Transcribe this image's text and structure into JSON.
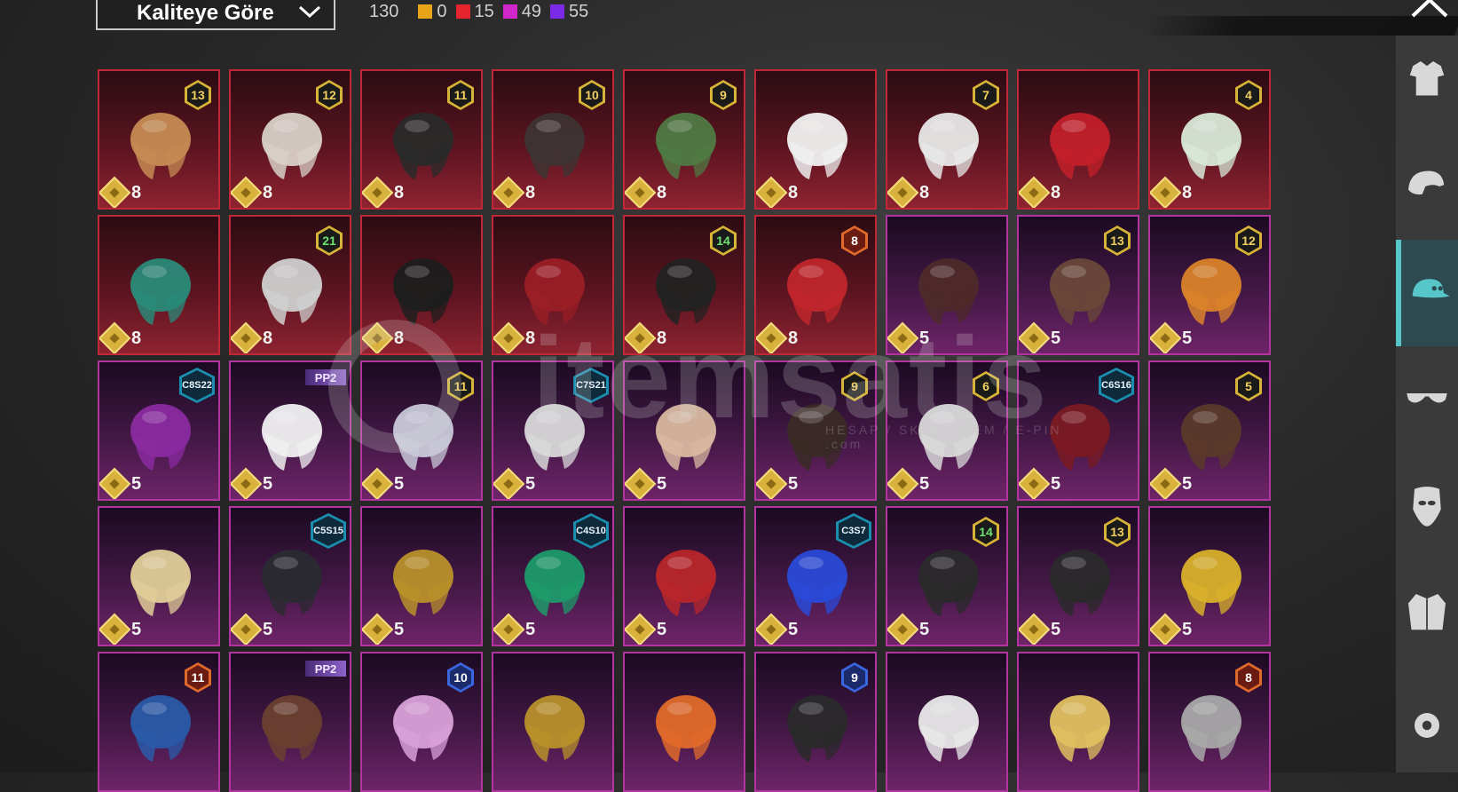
{
  "header": {
    "sort_label": "Kaliteye Göre",
    "total_count": "130",
    "stats": [
      {
        "color": "#e8a316",
        "value": "0"
      },
      {
        "color": "#e4252e",
        "value": "15"
      },
      {
        "color": "#d126c9",
        "value": "49"
      },
      {
        "color": "#7a2ae6",
        "value": "55"
      }
    ]
  },
  "watermark": {
    "text": "itemsatis",
    "sub": "HESAP / SKIN / ITEM / E-PIN .com"
  },
  "items": [
    {
      "rarity": "red",
      "badge": "13",
      "badge_type": "gold",
      "cost": "8",
      "icon": "flat-hat-hair-icon",
      "tone": "#c58b53"
    },
    {
      "rarity": "red",
      "badge": "12",
      "badge_type": "gold",
      "cost": "8",
      "icon": "silver-hair-icon",
      "tone": "#d8d0c8"
    },
    {
      "rarity": "red",
      "badge": "11",
      "badge_type": "gold",
      "cost": "8",
      "icon": "black-hair-icon",
      "tone": "#2a2a2a"
    },
    {
      "rarity": "red",
      "badge": "10",
      "badge_type": "gold",
      "cost": "8",
      "icon": "dark-hair-icon",
      "tone": "#3e3434"
    },
    {
      "rarity": "red",
      "badge": "9",
      "badge_type": "gold",
      "cost": "8",
      "icon": "zombie-head-icon",
      "tone": "#4f7a44"
    },
    {
      "rarity": "red",
      "badge": "",
      "badge_type": "none",
      "cost": "8",
      "icon": "white-cowboy-hat-icon",
      "tone": "#f0f0f0"
    },
    {
      "rarity": "red",
      "badge": "7",
      "badge_type": "gold",
      "cost": "8",
      "icon": "white-long-hair-icon",
      "tone": "#e8e8e8"
    },
    {
      "rarity": "red",
      "badge": "",
      "badge_type": "none",
      "cost": "8",
      "icon": "red-helmet-icon",
      "tone": "#c1202a"
    },
    {
      "rarity": "red",
      "badge": "4",
      "badge_type": "gold",
      "cost": "8",
      "icon": "snowman-top-hat-icon",
      "tone": "#d8e8d8"
    },
    {
      "rarity": "red",
      "badge": "",
      "badge_type": "none",
      "cost": "8",
      "icon": "dragon-mask-icon",
      "tone": "#2a8a78"
    },
    {
      "rarity": "red",
      "badge": "21",
      "badge_type": "green",
      "cost": "8",
      "icon": "oni-mask-icon",
      "tone": "#cfcfcf"
    },
    {
      "rarity": "red",
      "badge": "",
      "badge_type": "none",
      "cost": "8",
      "icon": "fox-mask-icon",
      "tone": "#1e1e1e"
    },
    {
      "rarity": "red",
      "badge": "",
      "badge_type": "none",
      "cost": "8",
      "icon": "red-visor-helmet-icon",
      "tone": "#9a1e26"
    },
    {
      "rarity": "red",
      "badge": "14",
      "badge_type": "green",
      "cost": "8",
      "icon": "golden-antler-hood-icon",
      "tone": "#222222"
    },
    {
      "rarity": "red",
      "badge": "8",
      "badge_type": "orange",
      "cost": "8",
      "icon": "red-samurai-hat-icon",
      "tone": "#c0262c"
    },
    {
      "rarity": "purple",
      "badge": "",
      "badge_type": "none",
      "cost": "5",
      "icon": "brown-hair-icon",
      "tone": "#4e2a2a"
    },
    {
      "rarity": "purple",
      "badge": "13",
      "badge_type": "gold",
      "cost": "5",
      "icon": "goggles-hair-icon",
      "tone": "#6a4838"
    },
    {
      "rarity": "purple",
      "badge": "12",
      "badge_type": "gold",
      "cost": "5",
      "icon": "orange-hair-icon",
      "tone": "#d9822a"
    },
    {
      "rarity": "purple",
      "badge": "C8S22",
      "badge_type": "season",
      "cost": "5",
      "icon": "purple-hair-icon",
      "tone": "#8a2aa0"
    },
    {
      "rarity": "purple",
      "badge": "PP2",
      "badge_type": "pass",
      "cost": "5",
      "icon": "panda-head-icon",
      "tone": "#f0f0f0"
    },
    {
      "rarity": "purple",
      "badge": "11",
      "badge_type": "gold",
      "cost": "5",
      "icon": "flower-crown-hair-icon",
      "tone": "#c8c8d8"
    },
    {
      "rarity": "purple",
      "badge": "C7S21",
      "badge_type": "season",
      "cost": "5",
      "icon": "silver-spiky-hair-icon",
      "tone": "#d8d8d8"
    },
    {
      "rarity": "purple",
      "badge": "",
      "badge_type": "none",
      "cost": "5",
      "icon": "blonde-buns-hair-icon",
      "tone": "#d8b8a0"
    },
    {
      "rarity": "purple",
      "badge": "9",
      "badge_type": "gold",
      "cost": "5",
      "icon": "ponytail-hair-icon",
      "tone": "#3a2a26"
    },
    {
      "rarity": "purple",
      "badge": "6",
      "badge_type": "gold",
      "cost": "5",
      "icon": "bird-helmet-icon",
      "tone": "#d8d8d8"
    },
    {
      "rarity": "purple",
      "badge": "C6S16",
      "badge_type": "season",
      "cost": "5",
      "icon": "red-hair-icon",
      "tone": "#7a1a22"
    },
    {
      "rarity": "purple",
      "badge": "5",
      "badge_type": "gold",
      "cost": "5",
      "icon": "bunny-ears-hair-icon",
      "tone": "#5a3a2a"
    },
    {
      "rarity": "purple",
      "badge": "",
      "badge_type": "none",
      "cost": "5",
      "icon": "blonde-curls-hair-icon",
      "tone": "#e0cc98"
    },
    {
      "rarity": "purple",
      "badge": "C5S15",
      "badge_type": "season",
      "cost": "5",
      "icon": "black-cap-icon",
      "tone": "#2a2a30"
    },
    {
      "rarity": "purple",
      "badge": "",
      "badge_type": "none",
      "cost": "5",
      "icon": "golden-anubis-helmet-icon",
      "tone": "#b8902a"
    },
    {
      "rarity": "purple",
      "badge": "C4S10",
      "badge_type": "season",
      "cost": "5",
      "icon": "green-dragon-helmet-icon",
      "tone": "#1e9a6a"
    },
    {
      "rarity": "purple",
      "badge": "",
      "badge_type": "none",
      "cost": "5",
      "icon": "red-twin-hair-icon",
      "tone": "#b8262a"
    },
    {
      "rarity": "purple",
      "badge": "C3S7",
      "badge_type": "season",
      "cost": "5",
      "icon": "blue-bow-headpiece-icon",
      "tone": "#2a4ad8"
    },
    {
      "rarity": "purple",
      "badge": "14",
      "badge_type": "green",
      "cost": "5",
      "icon": "headband-hair-icon",
      "tone": "#2a2a2a"
    },
    {
      "rarity": "purple",
      "badge": "13",
      "badge_type": "gold",
      "cost": "5",
      "icon": "devil-horn-helmet-icon",
      "tone": "#2a2a2a"
    },
    {
      "rarity": "purple",
      "badge": "",
      "badge_type": "none",
      "cost": "5",
      "icon": "golden-crown-mask-icon",
      "tone": "#d8b02a"
    },
    {
      "rarity": "purple",
      "badge": "11",
      "badge_type": "orange",
      "cost": "",
      "icon": "blue-beanie-icon",
      "tone": "#2a5aa8"
    },
    {
      "rarity": "purple",
      "badge": "PP2",
      "badge_type": "pass",
      "cost": "",
      "icon": "gas-mask-icon",
      "tone": "#6a4030"
    },
    {
      "rarity": "purple",
      "badge": "10",
      "badge_type": "blue",
      "cost": "",
      "icon": "pink-helmet-icon",
      "tone": "#d8a0d8"
    },
    {
      "rarity": "purple",
      "badge": "",
      "badge_type": "none",
      "cost": "",
      "icon": "golden-crown-icon",
      "tone": "#b8902a"
    },
    {
      "rarity": "purple",
      "badge": "",
      "badge_type": "none",
      "cost": "",
      "icon": "orange-antler-helmet-icon",
      "tone": "#e06a2a"
    },
    {
      "rarity": "purple",
      "badge": "9",
      "badge_type": "blue",
      "cost": "",
      "icon": "dreadlock-helmet-icon",
      "tone": "#2a2a2a"
    },
    {
      "rarity": "purple",
      "badge": "",
      "badge_type": "none",
      "cost": "",
      "icon": "snowman-hat-icon",
      "tone": "#e8e8e8"
    },
    {
      "rarity": "purple",
      "badge": "",
      "badge_type": "none",
      "cost": "",
      "icon": "paper-bag-mask-icon",
      "tone": "#e0c060"
    },
    {
      "rarity": "purple",
      "badge": "8",
      "badge_type": "orange",
      "cost": "",
      "icon": "kettle-helmet-icon",
      "tone": "#a8a8a8"
    }
  ],
  "sidebar": [
    {
      "icon": "outfit-icon",
      "active": false
    },
    {
      "icon": "helmet-icon",
      "active": false
    },
    {
      "icon": "cap-icon",
      "active": true
    },
    {
      "icon": "glasses-icon",
      "active": false
    },
    {
      "icon": "mask-icon",
      "active": false
    },
    {
      "icon": "jacket-icon",
      "active": false
    },
    {
      "icon": "gear-icon",
      "active": false
    }
  ]
}
